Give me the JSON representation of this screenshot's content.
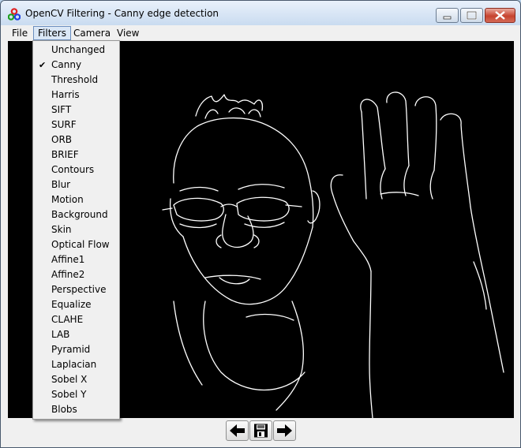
{
  "window": {
    "title": "OpenCV Filtering - Canny edge detection"
  },
  "menubar": {
    "items": [
      {
        "label": "File"
      },
      {
        "label": "Filters"
      },
      {
        "label": "Camera"
      },
      {
        "label": "View"
      }
    ]
  },
  "filters_menu": {
    "checked": "Canny",
    "items": [
      {
        "label": "Unchanged"
      },
      {
        "label": "Canny"
      },
      {
        "label": "Threshold"
      },
      {
        "label": "Harris"
      },
      {
        "label": "SIFT"
      },
      {
        "label": "SURF"
      },
      {
        "label": "ORB"
      },
      {
        "label": "BRIEF"
      },
      {
        "label": "Contours"
      },
      {
        "label": "Blur"
      },
      {
        "label": "Motion"
      },
      {
        "label": "Background"
      },
      {
        "label": "Skin"
      },
      {
        "label": "Optical Flow"
      },
      {
        "label": "Affine1"
      },
      {
        "label": "Affine2"
      },
      {
        "label": "Perspective"
      },
      {
        "label": "Equalize"
      },
      {
        "label": "CLAHE"
      },
      {
        "label": "LAB"
      },
      {
        "label": "Pyramid"
      },
      {
        "label": "Laplacian"
      },
      {
        "label": "Sobel X"
      },
      {
        "label": "Sobel Y"
      },
      {
        "label": "Blobs"
      }
    ]
  },
  "toolbar": {
    "buttons": [
      {
        "icon": "arrow-left-icon"
      },
      {
        "icon": "save-icon"
      },
      {
        "icon": "arrow-right-icon"
      }
    ]
  },
  "colors": {
    "canvas_bg": "#000000",
    "edge_color": "#ffffff",
    "close_button": "#c6432f",
    "menu_highlight": "#dae7f6"
  }
}
